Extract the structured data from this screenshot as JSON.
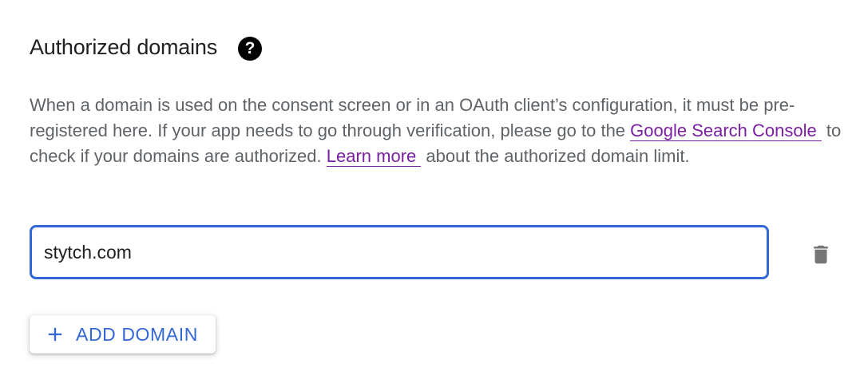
{
  "section": {
    "title": "Authorized domains",
    "help_icon": "help-circle-icon",
    "description": {
      "part1": "When a domain is used on the consent screen or in an OAuth client’s configuration, it must be pre-registered here. If your app needs to go through verification, please go to the ",
      "link1": "Google Search Console",
      "part2": "to check if your domains are authorized. ",
      "link2": "Learn more",
      "part3": "about the authorized domain limit."
    }
  },
  "domains": [
    {
      "value": "stytch.com",
      "delete_icon": "trash-icon"
    }
  ],
  "add_button": {
    "label": "ADD DOMAIN",
    "icon": "plus-icon"
  },
  "colors": {
    "accent": "#3367d6",
    "link": "#7b1fa2",
    "text": "#202124",
    "secondary_text": "#5f6368",
    "icon": "#757575"
  }
}
